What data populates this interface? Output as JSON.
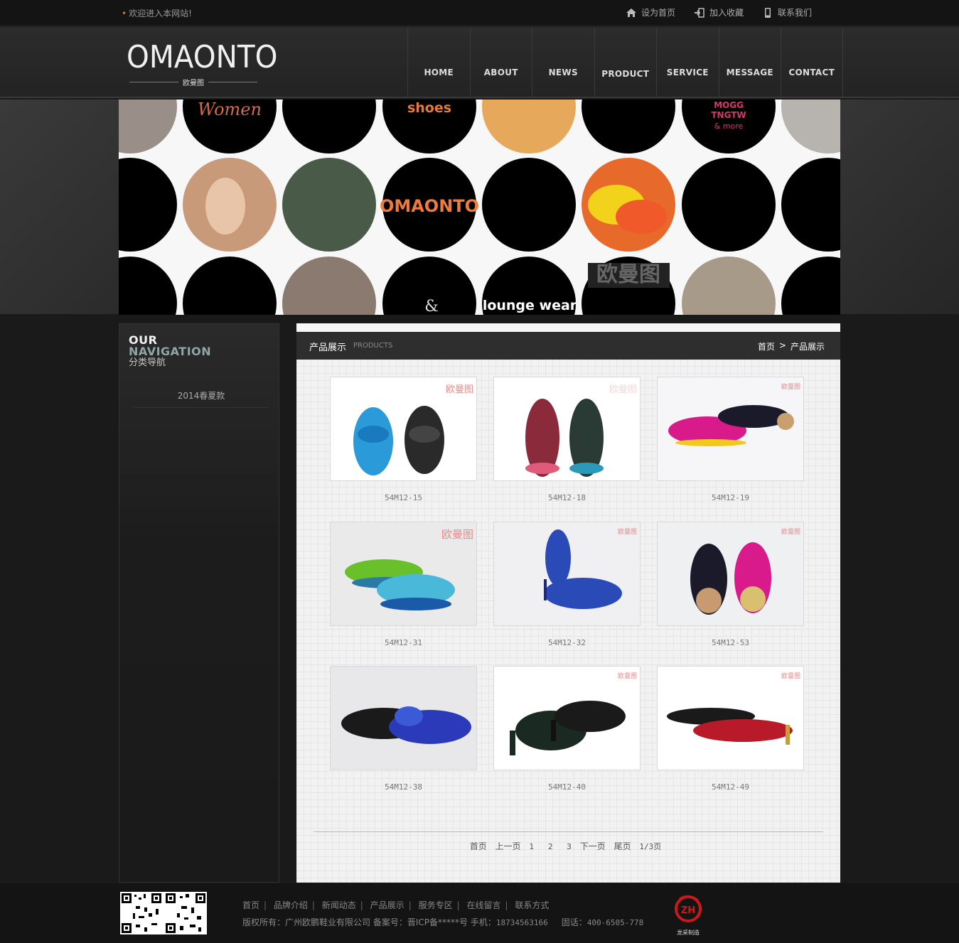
{
  "topbar": {
    "welcome": "欢迎进入本网站!",
    "links": [
      {
        "label": "设为首页",
        "icon": "home-icon"
      },
      {
        "label": "加入收藏",
        "icon": "bookmark-icon"
      },
      {
        "label": "联系我们",
        "icon": "phone-icon"
      }
    ]
  },
  "logo": {
    "text": "OMAONTO",
    "sub": "欧曼图"
  },
  "nav": [
    "HOME",
    "ABOUT",
    "NEWS",
    "PRODUCT",
    "SERVICE",
    "MESSAGE",
    "CONTACT"
  ],
  "banner": {
    "labels": {
      "women": "Women",
      "shoes": "shoes",
      "mogg1": "MOGG",
      "mogg2": "TNGTW",
      "mogg3": "& more",
      "brand": "OMAONTO",
      "amp": "&",
      "lounge": "lounge wear",
      "cn": "欧曼图"
    }
  },
  "sidebar": {
    "title_en1": "OUR",
    "title_en2": "NAVIGATION",
    "title_cn": "分类导航",
    "items": [
      "2014春夏款"
    ]
  },
  "main": {
    "title_cn": "产品展示",
    "title_en": "PRODUCTS",
    "breadcrumb": {
      "home": "首页",
      "sep": ">",
      "current": "产品展示"
    }
  },
  "products": [
    {
      "code": "54M12-15",
      "watermark": "欧曼图"
    },
    {
      "code": "54M12-18",
      "watermark": "欧曼图"
    },
    {
      "code": "54M12-19",
      "watermark": "欧曼图"
    },
    {
      "code": "54M12-31",
      "watermark": "欧曼图"
    },
    {
      "code": "54M12-32",
      "watermark": "欧曼图"
    },
    {
      "code": "54M12-53",
      "watermark": "欧曼图"
    },
    {
      "code": "54M12-38",
      "watermark": ""
    },
    {
      "code": "54M12-40",
      "watermark": "欧曼图"
    },
    {
      "code": "54M12-49",
      "watermark": "欧曼图"
    }
  ],
  "pager": {
    "first": "首页",
    "prev": "上一页",
    "pages": [
      "1",
      "2",
      "3"
    ],
    "next": "下一页",
    "last": "尾页",
    "info": "1/3页"
  },
  "footer": {
    "links": [
      "首页",
      "品牌介绍",
      "新闻动态",
      "产品展示",
      "服务专区",
      "在线留言",
      "联系方式"
    ],
    "copyright": "版权所有：广州欧鹏鞋业有限公司",
    "icp_label": "备案号：",
    "icp": "晋ICP备*****号",
    "mobile_label": "手机：",
    "mobile": "18734563166",
    "tel_label": "固话：",
    "tel": "400-6505-778",
    "maker": "龙采制造"
  }
}
